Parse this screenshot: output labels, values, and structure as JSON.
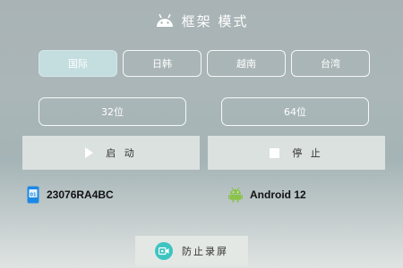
{
  "header": {
    "icon": "android-icon",
    "title": "框架 模式"
  },
  "regions": {
    "items": [
      {
        "label": "国际",
        "selected": true
      },
      {
        "label": "日韩",
        "selected": false
      },
      {
        "label": "越南",
        "selected": false
      },
      {
        "label": "台湾",
        "selected": false
      }
    ]
  },
  "architectures": {
    "items": [
      {
        "label": "32位"
      },
      {
        "label": "64位"
      }
    ]
  },
  "actions": {
    "start": {
      "icon": "play-icon",
      "label": "启 动"
    },
    "stop": {
      "icon": "stop-icon",
      "label": "停 止"
    }
  },
  "device_info": {
    "model": {
      "icon": "phone-icon",
      "value": "23076RA4BC"
    },
    "os": {
      "icon": "android-icon",
      "value": "Android 12"
    }
  },
  "record_prevention": {
    "icon": "screen-record-icon",
    "label": "防止录屏"
  },
  "colors": {
    "accent": "#3fc4c0",
    "selected_region": "#c4dddf",
    "android_green": "#8bc34a"
  }
}
